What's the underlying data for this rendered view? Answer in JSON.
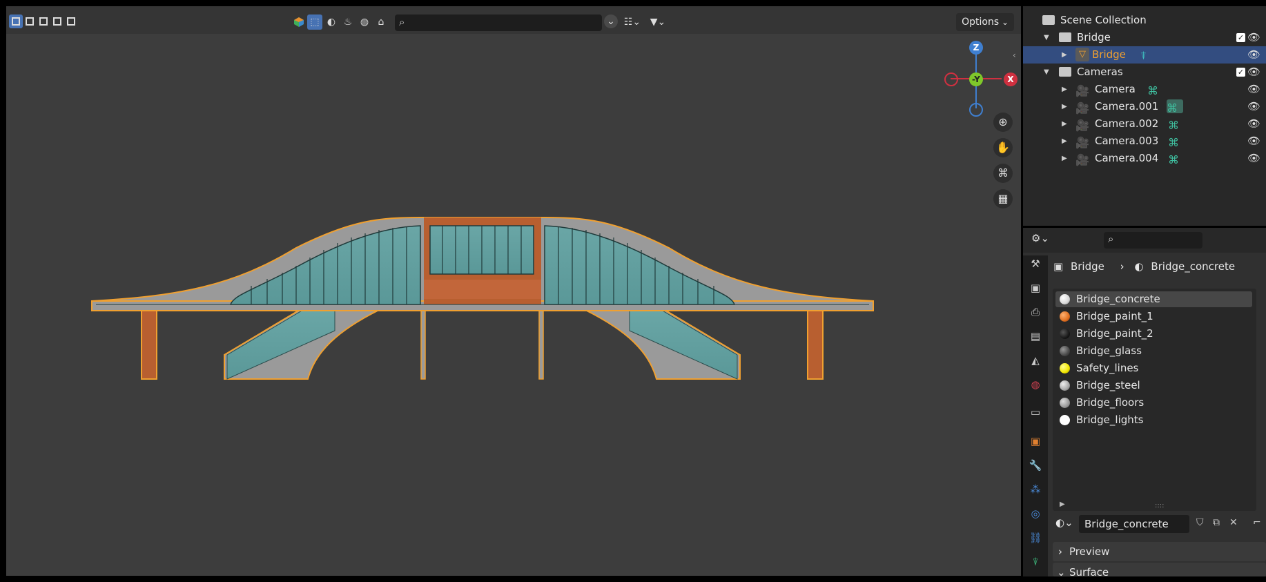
{
  "viewport": {
    "options_label": "Options",
    "gizmo": {
      "z": "Z",
      "y": "-Y",
      "x": "X"
    }
  },
  "outliner": {
    "rows": [
      {
        "label": "Scene Collection"
      },
      {
        "label": "Bridge"
      },
      {
        "label": "Bridge"
      },
      {
        "label": "Cameras"
      },
      {
        "label": "Camera"
      },
      {
        "label": "Camera.001"
      },
      {
        "label": "Camera.002"
      },
      {
        "label": "Camera.003"
      },
      {
        "label": "Camera.004"
      }
    ]
  },
  "properties": {
    "breadcrumb": {
      "object": "Bridge",
      "material": "Bridge_concrete"
    },
    "materials": [
      {
        "name": "Bridge_concrete",
        "color": "#d9d9d9"
      },
      {
        "name": "Bridge_paint_1",
        "color": "#e07020"
      },
      {
        "name": "Bridge_paint_2",
        "color": "#1a1a1a"
      },
      {
        "name": "Bridge_glass",
        "color": "#4a4a4a"
      },
      {
        "name": "Safety_lines",
        "color": "#f2e600"
      },
      {
        "name": "Bridge_steel",
        "color": "#a8a8a8"
      },
      {
        "name": "Bridge_floors",
        "color": "#9a9a9a"
      },
      {
        "name": "Bridge_lights",
        "color": "#ffffff"
      }
    ],
    "slot_name": "Bridge_concrete",
    "panels": {
      "preview": "Preview",
      "surface": "Surface"
    }
  },
  "colors": {
    "selection_blue": "#4772b3",
    "outliner_selected": "#334d80",
    "selected_object_text": "#f0a030"
  }
}
